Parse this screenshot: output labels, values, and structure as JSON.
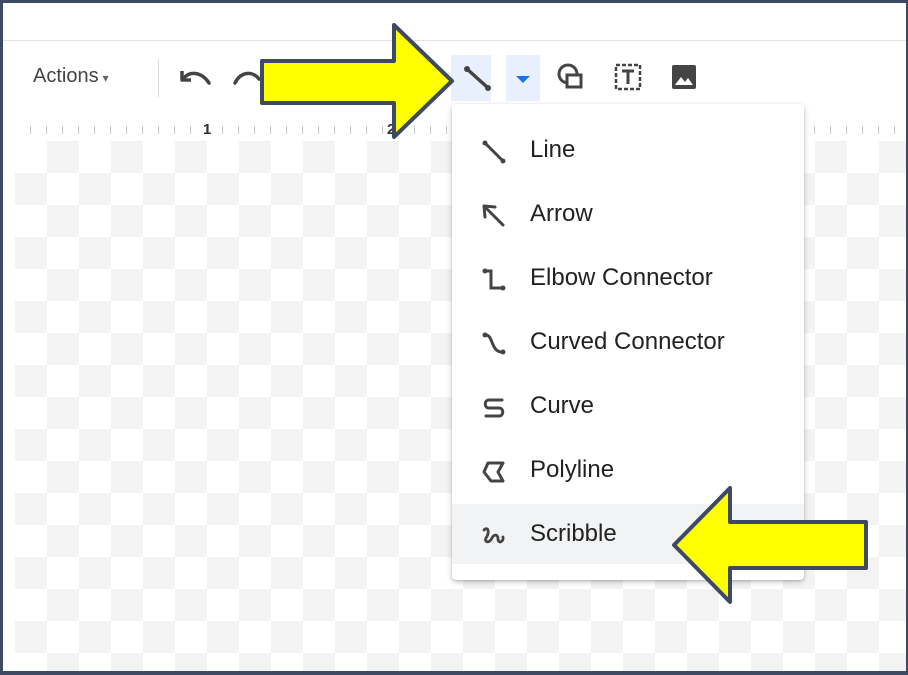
{
  "toolbar": {
    "actions_label": "Actions",
    "actions_caret": "▾",
    "icons": [
      "undo-icon",
      "redo-icon",
      "line-icon",
      "dropdown-caret-icon",
      "shape-icon",
      "text-box-icon",
      "image-icon"
    ]
  },
  "ruler": {
    "numbers": [
      "1",
      "2"
    ]
  },
  "line_menu": {
    "items": [
      {
        "label": "Line",
        "icon": "line-icon"
      },
      {
        "label": "Arrow",
        "icon": "arrow-icon"
      },
      {
        "label": "Elbow Connector",
        "icon": "elbow-connector-icon"
      },
      {
        "label": "Curved Connector",
        "icon": "curved-connector-icon"
      },
      {
        "label": "Curve",
        "icon": "curve-icon"
      },
      {
        "label": "Polyline",
        "icon": "polyline-icon"
      },
      {
        "label": "Scribble",
        "icon": "scribble-icon",
        "selected": true
      }
    ]
  },
  "colors": {
    "frame_border": "#3e4a63",
    "callout_arrow_fill": "#ffff00",
    "callout_arrow_stroke": "#3e4a63",
    "selected_button_bg": "#e8f0fe",
    "accent_blue": "#1a73e8"
  }
}
